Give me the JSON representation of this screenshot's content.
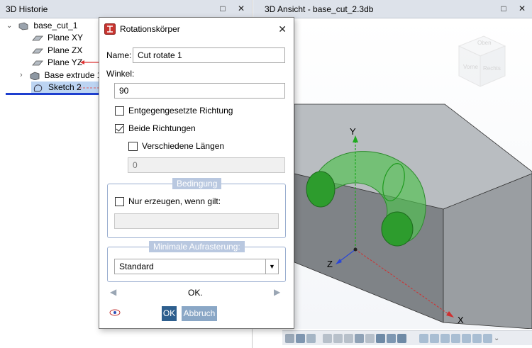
{
  "left_panel": {
    "title": "3D Historie",
    "tree": {
      "root": "base_cut_1",
      "items": [
        "Plane XY",
        "Plane ZX",
        "Plane YZ",
        "Base extrude 1",
        "Sketch 2"
      ]
    }
  },
  "right_panel": {
    "title": "3D Ansicht - base_cut_2.3db",
    "viewcube": {
      "top": "Oben",
      "front": "Vorne",
      "right": "Rechts"
    },
    "axes": {
      "x": "X",
      "y": "Y",
      "z": "Z"
    }
  },
  "dialog": {
    "title": "Rotationskörper",
    "name_label": "Name:",
    "name_value": "Cut rotate 1",
    "angle_label": "Winkel:",
    "angle_value": "90",
    "opposite_direction": "Entgegengesetzte Richtung",
    "both_directions": "Beide Richtungen",
    "different_lengths": "Verschiedene Längen",
    "length_value": "0",
    "condition_group": "Bedingung",
    "condition_checkbox": "Nur erzeugen, wenn gilt:",
    "condition_value": "",
    "raster_group": "Minimale Aufrasterung:",
    "raster_value": "Standard",
    "nav_label": "OK.",
    "ok_label": "OK",
    "cancel_label": "Abbruch",
    "state": {
      "opposite_direction": false,
      "both_directions": true,
      "different_lengths": false,
      "condition": false
    }
  },
  "colors": {
    "accent": "#4a7fb0",
    "ok_button": "#2e5f8e",
    "cancel_button": "#8aa7c6",
    "header": "#dde2ea",
    "selection": "#bcd4f2",
    "tree_underline": "#1e3fcf"
  }
}
